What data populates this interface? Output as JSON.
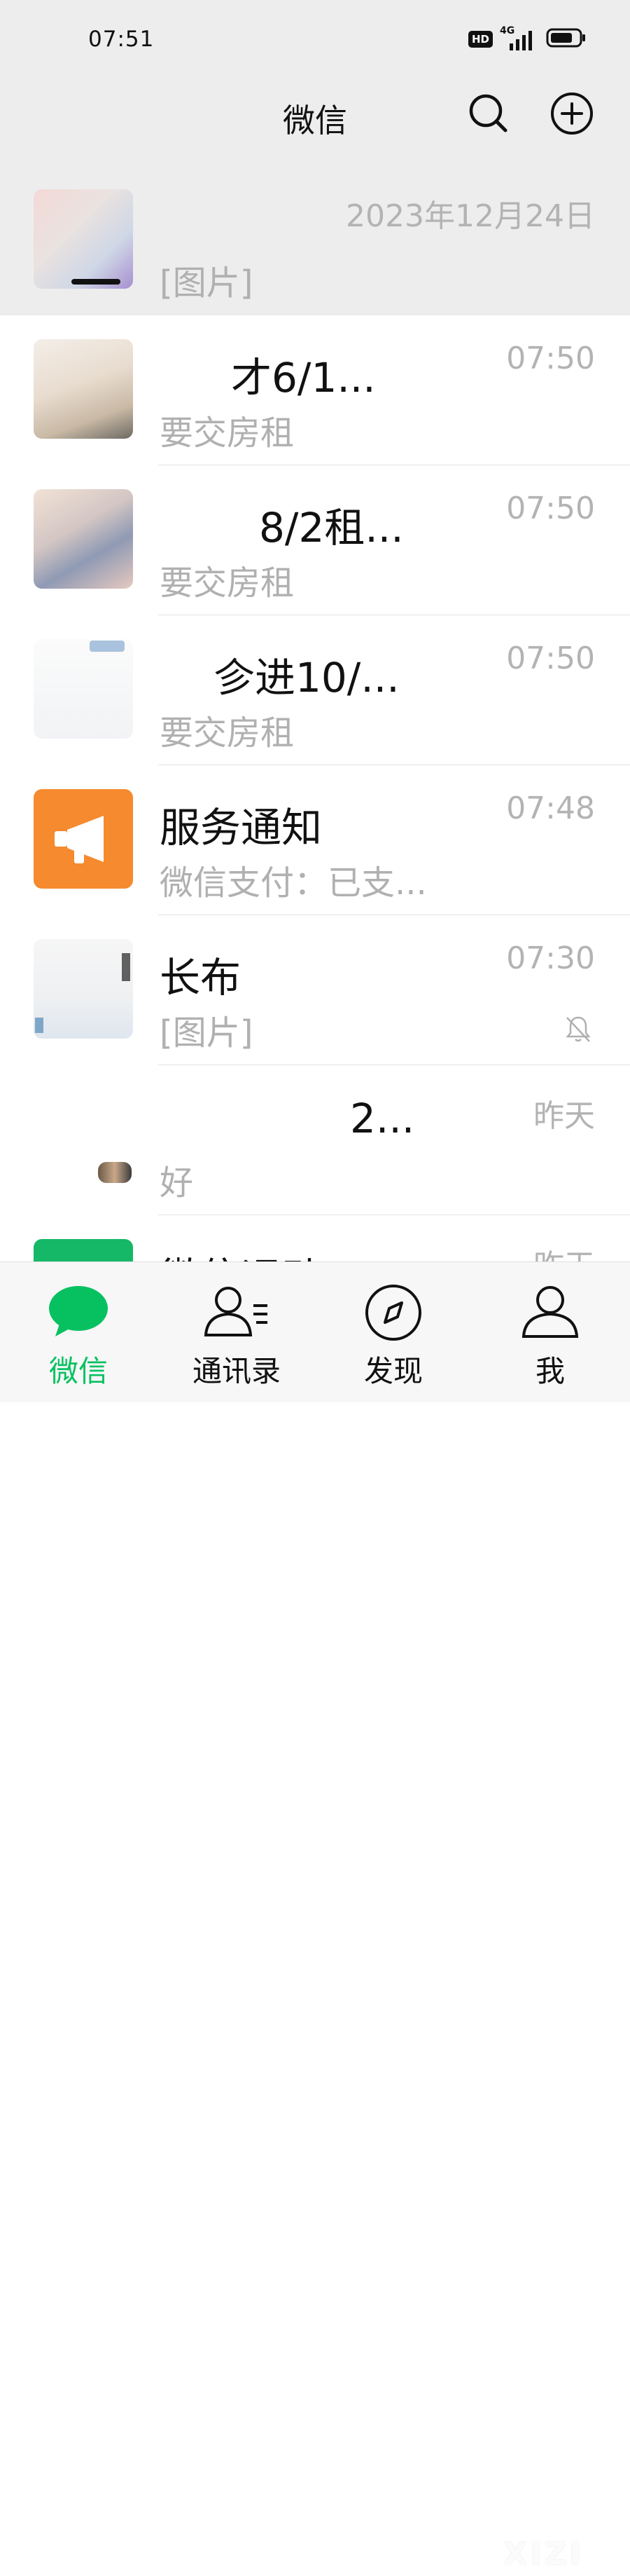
{
  "status_bar": {
    "time": "07:51",
    "hd": "HD",
    "network": "4G"
  },
  "header": {
    "title": "微信"
  },
  "chats": [
    {
      "name": "",
      "preview": "[图片]",
      "time": "2023年12月24日",
      "pinned": true,
      "muted": false,
      "avatar_type": "photo"
    },
    {
      "name": "才6/1...",
      "preview": "要交房租",
      "time": "07:50",
      "pinned": false,
      "muted": false,
      "avatar_type": "photo"
    },
    {
      "name": "8/2租...",
      "preview": "要交房租",
      "time": "07:50",
      "pinned": false,
      "muted": false,
      "avatar_type": "photo"
    },
    {
      "name": "㐱进10/...",
      "preview": "要交房租",
      "time": "07:50",
      "pinned": false,
      "muted": false,
      "avatar_type": "photo"
    },
    {
      "name": "服务通知",
      "preview": "微信支付：已支...",
      "time": "07:48",
      "pinned": false,
      "muted": false,
      "avatar_type": "service-notification"
    },
    {
      "name": "长布",
      "preview": "[图片]",
      "time": "07:30",
      "pinned": false,
      "muted": true,
      "avatar_type": "photo"
    },
    {
      "name": "2...",
      "preview": "好",
      "time": "昨天",
      "pinned": false,
      "muted": false,
      "avatar_type": "photo"
    },
    {
      "name": "微信运动",
      "preview": "",
      "time": "昨天",
      "pinned": false,
      "muted": false,
      "avatar_type": "wechat-sports"
    }
  ],
  "tabbar": {
    "tabs": [
      {
        "label": "微信",
        "icon": "chat-bubble-icon",
        "active": true
      },
      {
        "label": "通讯录",
        "icon": "contacts-icon",
        "active": false
      },
      {
        "label": "发现",
        "icon": "compass-icon",
        "active": false
      },
      {
        "label": "我",
        "icon": "person-icon",
        "active": false
      }
    ]
  },
  "watermark": "XIZI",
  "colors": {
    "accent": "#07c160",
    "service_orange": "#f58a2e",
    "header_bg": "#ededed"
  }
}
